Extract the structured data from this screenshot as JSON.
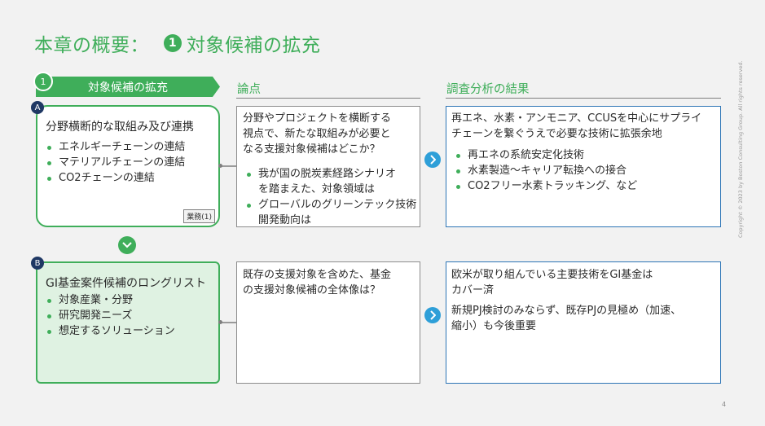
{
  "title": {
    "main": "本章の概要：",
    "number": "1",
    "sub": "対象候補の拡充"
  },
  "tab": {
    "number": "1",
    "label": "対象候補の拡充"
  },
  "columns": {
    "points": "論点",
    "results": "調査分析の結果"
  },
  "card_a": {
    "letter": "A",
    "title": "分野横断的な取組み及び連携",
    "items": [
      "エネルギーチェーンの連結",
      "マテリアルチェーンの連結",
      "CO2チェーンの連結"
    ],
    "badge": "業務(1)"
  },
  "card_b": {
    "letter": "B",
    "title": "GI基金案件候補のロングリスト",
    "items": [
      "対象産業・分野",
      "研究開発ニーズ",
      "想定するソリューション"
    ]
  },
  "point_a": {
    "lines": [
      "分野やプロジェクトを横断する",
      "視点で、新たな取組みが必要と",
      "なる支援対象候補はどこか？"
    ],
    "items": [
      [
        "我が国の脱炭素経路シナリオ",
        "を踏まえた、対象領域は"
      ],
      [
        "グローバルのグリーンテック技術",
        "開発動向は"
      ]
    ]
  },
  "point_b": {
    "lines": [
      "既存の支援対象を含めた、基金",
      "の支援対象候補の全体像は？"
    ]
  },
  "result_a": {
    "lines": [
      "再エネ、水素・アンモニア、CCUSを中心にサプライ",
      "チェーンを繋ぐうえで必要な技術に拡張余地"
    ],
    "items": [
      "再エネの系統安定化技術",
      "水素製造～キャリア転換への接合",
      "CO2フリー水素トラッキング、など"
    ]
  },
  "result_b": {
    "p1": [
      "欧米が取り組んでいる主要技術をGI基金は",
      "カバー済"
    ],
    "p2": [
      "新規PJ検討のみならず、既存PJの見極め（加速、",
      "縮小）も今後重要"
    ]
  },
  "footer": {
    "copyright": "Copyright © 2023 by Boston Consulting Group. All rights reserved.",
    "page": "4"
  },
  "colors": {
    "green": "#3fae5a",
    "navy": "#1f3864",
    "blue": "#2e75b6",
    "arrow_blue": "#2e9fd8"
  },
  "icons": {
    "arrow": "chevron-right-icon",
    "down": "chevron-down-icon"
  }
}
